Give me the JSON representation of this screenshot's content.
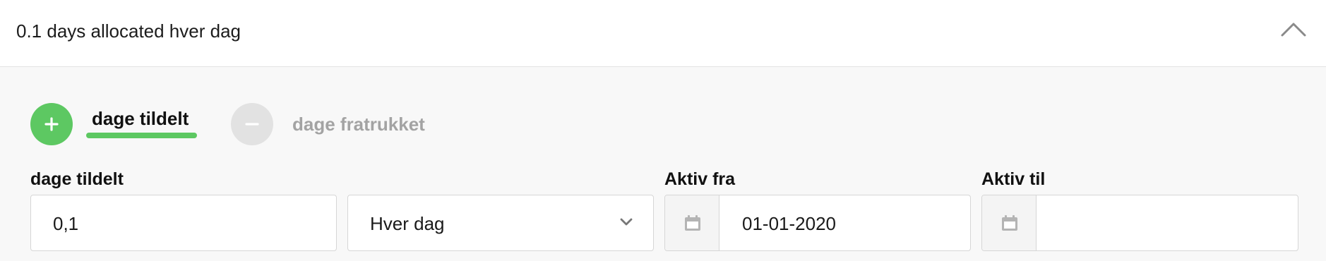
{
  "header": {
    "title": "0.1 days allocated hver dag"
  },
  "toggle": {
    "add_label": "dage tildelt",
    "subtract_label": "dage fratrukket",
    "add_color": "#5dc862",
    "subtract_color": "#e2e2e2"
  },
  "form": {
    "amount_label": "dage tildelt",
    "amount_value": "0,1",
    "frequency_selected": "Hver dag",
    "active_from_label": "Aktiv fra",
    "active_from_value": "01-01-2020",
    "active_to_label": "Aktiv til",
    "active_to_value": ""
  },
  "icons": {
    "collapse": "chevron-up-icon",
    "add": "plus-icon",
    "subtract": "minus-icon",
    "dropdown": "chevron-down-icon",
    "date": "calendar-icon"
  }
}
